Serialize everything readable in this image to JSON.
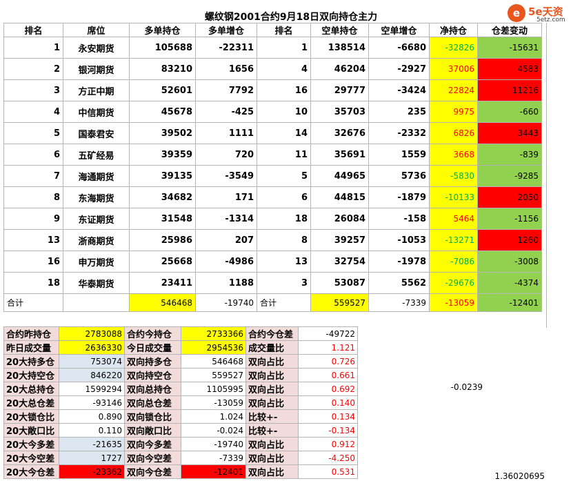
{
  "title": "螺纹钢2001合约9月18日双向持仓主力",
  "logo": {
    "mark": "e",
    "brand": "5e天资",
    "site": "5etz.com"
  },
  "headers": [
    "排名",
    "席位",
    "多单持仓",
    "多单增仓",
    "排名",
    "空单持仓",
    "空单增仓",
    "净持仓",
    "仓差变动"
  ],
  "rows": [
    {
      "rank": "1",
      "name": "永安期货",
      "long": "105688",
      "long_chg": "-22311",
      "srank": "1",
      "short": "138514",
      "short_chg": "-6680",
      "net": "-32826",
      "diff": "-15631"
    },
    {
      "rank": "2",
      "name": "银河期货",
      "long": "83210",
      "long_chg": "1656",
      "srank": "4",
      "short": "46204",
      "short_chg": "-2927",
      "net": "37006",
      "diff": "4583"
    },
    {
      "rank": "3",
      "name": "方正中期",
      "long": "52601",
      "long_chg": "7792",
      "srank": "16",
      "short": "29777",
      "short_chg": "-3424",
      "net": "22824",
      "diff": "11216"
    },
    {
      "rank": "4",
      "name": "中信期货",
      "long": "45678",
      "long_chg": "-425",
      "srank": "10",
      "short": "35703",
      "short_chg": "235",
      "net": "9975",
      "diff": "-660"
    },
    {
      "rank": "5",
      "name": "国泰君安",
      "long": "39502",
      "long_chg": "1111",
      "srank": "14",
      "short": "32676",
      "short_chg": "-2332",
      "net": "6826",
      "diff": "3443"
    },
    {
      "rank": "6",
      "name": "五矿经易",
      "long": "39359",
      "long_chg": "720",
      "srank": "11",
      "short": "35691",
      "short_chg": "1559",
      "net": "3668",
      "diff": "-839"
    },
    {
      "rank": "7",
      "name": "海通期货",
      "long": "39135",
      "long_chg": "-3549",
      "srank": "5",
      "short": "44965",
      "short_chg": "5736",
      "net": "-5830",
      "diff": "-9285"
    },
    {
      "rank": "8",
      "name": "东海期货",
      "long": "34682",
      "long_chg": "171",
      "srank": "6",
      "short": "44815",
      "short_chg": "-1879",
      "net": "-10133",
      "diff": "2050"
    },
    {
      "rank": "9",
      "name": "东证期货",
      "long": "31548",
      "long_chg": "-1314",
      "srank": "18",
      "short": "26084",
      "short_chg": "-158",
      "net": "5464",
      "diff": "-1156"
    },
    {
      "rank": "13",
      "name": "浙商期货",
      "long": "25986",
      "long_chg": "207",
      "srank": "8",
      "short": "39257",
      "short_chg": "-1053",
      "net": "-13271",
      "diff": "1260"
    },
    {
      "rank": "16",
      "name": "申万期货",
      "long": "25668",
      "long_chg": "-4986",
      "srank": "13",
      "short": "32754",
      "short_chg": "-1978",
      "net": "-7086",
      "diff": "-3008"
    },
    {
      "rank": "18",
      "name": "华泰期货",
      "long": "23411",
      "long_chg": "1188",
      "srank": "3",
      "short": "53087",
      "short_chg": "5562",
      "net": "-29676",
      "diff": "-4374"
    }
  ],
  "total": {
    "label": "合计",
    "long": "546468",
    "long_chg": "-19740",
    "label2": "合计",
    "short": "559527",
    "short_chg": "-7339",
    "net": "-13059",
    "diff": "-12401"
  },
  "stats": [
    {
      "l1": "合约昨持仓",
      "v1": "2783088",
      "l2": "合约今持仓",
      "v2": "2733366",
      "l3": "合约今仓差",
      "v3": "-49722"
    },
    {
      "l1": "昨日成交量",
      "v1": "2636330",
      "l2": "今日成交量",
      "v2": "2954536",
      "l3": "成交量比",
      "v3": "1.121"
    },
    {
      "l1": "20大持多仓",
      "v1": "753074",
      "l2": "双向持多仓",
      "v2": "546468",
      "l3": "双向占比",
      "v3": "0.726"
    },
    {
      "l1": "20大持空仓",
      "v1": "846220",
      "l2": "双向持空仓",
      "v2": "559527",
      "l3": "双向占比",
      "v3": "0.661"
    },
    {
      "l1": "20大总持仓",
      "v1": "1599294",
      "l2": "双向总持仓",
      "v2": "1105995",
      "l3": "双向占比",
      "v3": "0.692"
    },
    {
      "l1": "20大总仓差",
      "v1": "-93146",
      "l2": "双向总仓差",
      "v2": "-13059",
      "l3": "双向占比",
      "v3": "0.140"
    },
    {
      "l1": "20大锁仓比",
      "v1": "0.890",
      "l2": "双向锁仓比",
      "v2": "1.024",
      "l3": "比较+-",
      "v3": "0.134"
    },
    {
      "l1": "20大敞口比",
      "v1": "0.110",
      "l2": "双向敞口比",
      "v2": "-0.024",
      "l3": "比较+-",
      "v3": "-0.134"
    },
    {
      "l1": "20大今多差",
      "v1": "-21635",
      "l2": "双向今多差",
      "v2": "-19740",
      "l3": "双向占比",
      "v3": "0.912"
    },
    {
      "l1": "20大今空差",
      "v1": "1727",
      "l2": "双向今空差",
      "v2": "-7339",
      "l3": "双向占比",
      "v3": "-4.250"
    },
    {
      "l1": "20大今仓差",
      "v1": "-23362",
      "l2": "双向今仓差",
      "v2": "-12401",
      "l3": "双向占比",
      "v3": "0.531"
    }
  ],
  "loose": {
    "a": "-0.0239",
    "b": "1.36020695"
  }
}
